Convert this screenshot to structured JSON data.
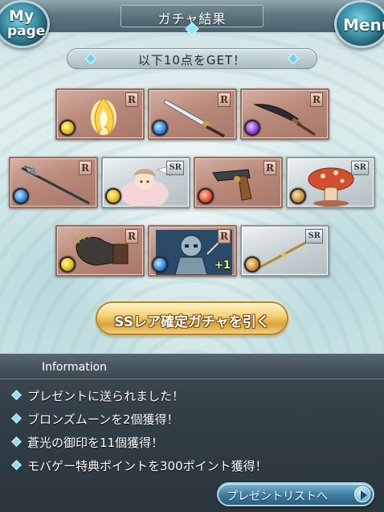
{
  "header": {
    "title": "ガチャ結果",
    "mypage_line1": "My",
    "mypage_line2": "page",
    "menu_label": "Menu"
  },
  "result_banner": "以下10点をGET！",
  "cards": [
    {
      "rarity": "R",
      "element": "light",
      "item": "flame-spirit"
    },
    {
      "rarity": "R",
      "element": "water",
      "item": "katana"
    },
    {
      "rarity": "R",
      "element": "dark",
      "item": "dagger"
    },
    {
      "rarity": "R",
      "element": "water",
      "item": "spear"
    },
    {
      "rarity": "SR",
      "element": "light",
      "item": "character-girl"
    },
    {
      "rarity": "R",
      "element": "fire",
      "item": "pistol"
    },
    {
      "rarity": "SR",
      "element": "earth",
      "item": "mushroom-creature"
    },
    {
      "rarity": "R",
      "element": "light",
      "item": "gauntlet"
    },
    {
      "rarity": "R",
      "element": "water",
      "item": "armored-skeleton",
      "bonus": "+1"
    },
    {
      "rarity": "SR",
      "element": "earth",
      "item": "golden-spear"
    }
  ],
  "ss_button_label": "SSレア確定ガチャを引く",
  "information": {
    "title": "Information",
    "items": [
      "プレゼントに送られました！",
      "ブロンズムーンを2個獲得！",
      "蒼光の御印を11個獲得！",
      "モバゲー特典ポイントを300ポイント獲得！"
    ],
    "present_list_button": "プレゼントリストへ"
  },
  "colors": {
    "header": "#5e7780",
    "card_r": "#b98a7a",
    "card_sr": "#c9d2d5",
    "ss_button": "#f6d27a",
    "info_panel": "#323e46"
  }
}
